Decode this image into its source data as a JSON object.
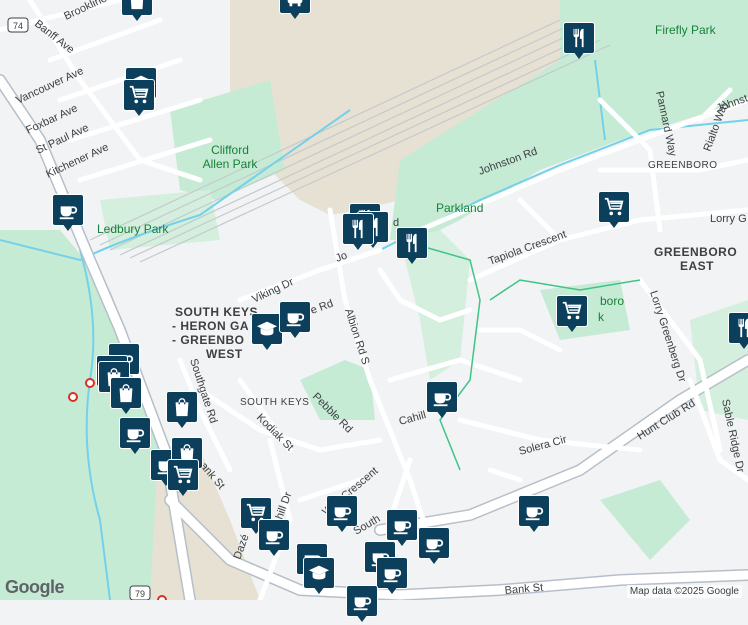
{
  "labels": {
    "firefly_park": "Firefly Park",
    "clifford_allen_park": "Clifford\nAllen Park",
    "ledbury_park": "Ledbury Park",
    "parkland": "Parkland",
    "johnston_rd": "Johnston Rd",
    "johnston_rd_east": "Johnst",
    "greenboro": "GREENBORO",
    "greenboro_east_1": "GREENBORO",
    "greenboro_east_2": "EAST",
    "south_keys_1": "SOUTH KEYS",
    "south_keys_2": "- HERON GA",
    "south_keys_3": "- GREENBO",
    "south_keys_4": "WEST",
    "south_keys_street": "SOUTH KEYS",
    "tapiola": "Tapiola Crescent",
    "hunt_club": "Hunt Club Rd",
    "albion": "Albion Rd S",
    "solera": "Solera Cir",
    "cahill": "Cahill",
    "pebble": "Pebble Rd",
    "kodiak": "Kodiak St",
    "southgate": "Southgate Rd",
    "bank_st": "Bank St",
    "bank_st_sw": "ank St",
    "viking": "Viking Dr",
    "lorry_greenberg": "Lorry Greenberg Dr",
    "lorry_g": "Lorry G",
    "sable_ridge": "Sable Ridge Dr",
    "pannard": "Pannard Way",
    "rialto": "Rialto Way",
    "banff": "Banff Ave",
    "vancouver": "Vancouver Ave",
    "foxbar": "Foxbar Ave",
    "st_paul": "St Paul Ave",
    "kitchener": "Kitchener Ave",
    "brookline": "Brookline",
    "route_74": "74",
    "route_79": "79",
    "hill_dr": "hill Dr",
    "daze": "Dazé",
    "south": "South",
    "jo": "Jo",
    "rd": "d",
    "way_crescent": "Way Crescent",
    "le_rd": "e Rd",
    "boro": "boro",
    "k": "k"
  },
  "footer": {
    "logo": "Google",
    "attribution": "Map data ©2025 Google"
  },
  "colors": {
    "water": "#74d1ea",
    "park": "#c6ebd5",
    "road": "#ffffff",
    "major_road": "#b6bfc9",
    "pin": "#0c3f5c",
    "industrial": "#e7e1d3"
  },
  "pins": [
    {
      "type": "bus-stop-icon"
    },
    {
      "type": "shopping-bag-icon"
    },
    {
      "type": "education-icon"
    },
    {
      "type": "cafe-icon"
    },
    {
      "type": "restaurant-icon"
    },
    {
      "type": "restaurant-icon"
    },
    {
      "type": "restaurant-icon"
    },
    {
      "type": "restaurant-icon"
    },
    {
      "type": "education-icon"
    },
    {
      "type": "grocery-cart-icon"
    },
    {
      "type": "cafe-icon"
    },
    {
      "type": "cafe-icon"
    },
    {
      "type": "cafe-icon"
    },
    {
      "type": "shopping-bag-icon"
    },
    {
      "type": "shopping-bag-icon"
    },
    {
      "type": "shopping-bag-icon"
    },
    {
      "type": "cafe-icon"
    },
    {
      "type": "cafe-icon"
    },
    {
      "type": "shopping-bag-icon"
    },
    {
      "type": "grocery-cart-icon"
    },
    {
      "type": "grocery-cart-icon"
    },
    {
      "type": "cafe-icon"
    },
    {
      "type": "cafe-icon"
    },
    {
      "type": "restaurant-icon"
    },
    {
      "type": "restaurant-icon"
    },
    {
      "type": "grocery-cart-icon"
    },
    {
      "type": "cafe-icon"
    },
    {
      "type": "cafe-icon"
    },
    {
      "type": "cafe-icon"
    }
  ]
}
